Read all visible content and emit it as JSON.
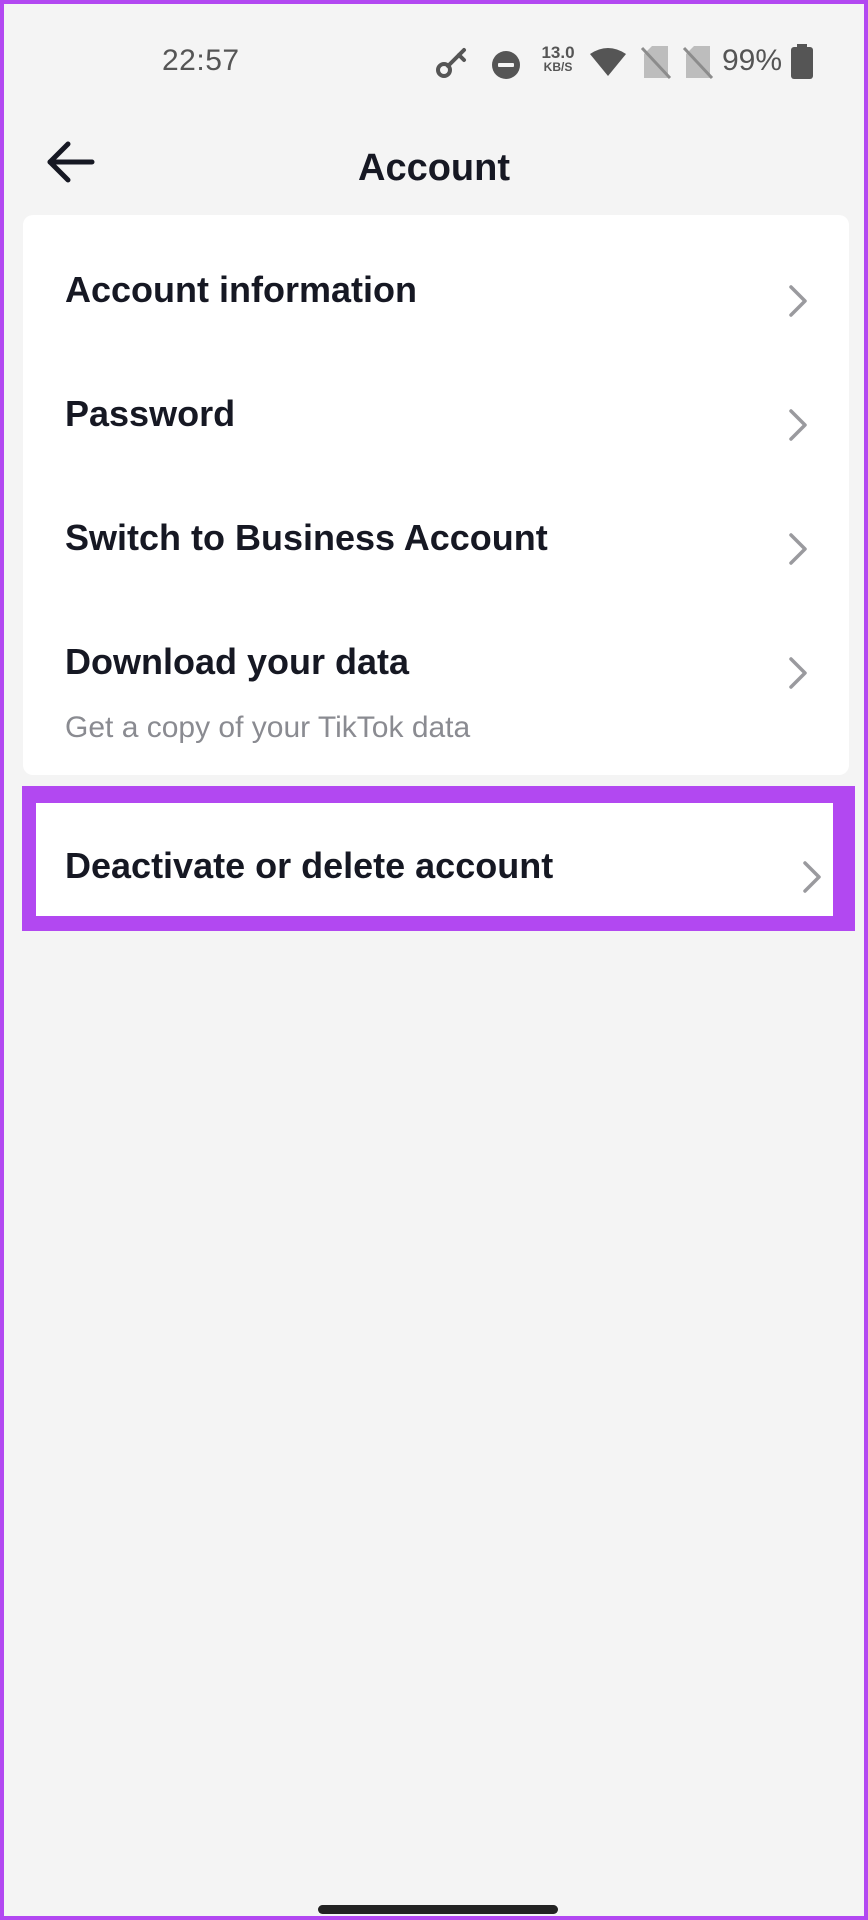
{
  "status_bar": {
    "time": "22:57",
    "net_speed_value": "13.0",
    "net_speed_unit": "KB/S",
    "battery_percent": "99%",
    "icons": [
      "vpn-key-icon",
      "do-not-disturb-icon",
      "wifi-icon",
      "no-sim-icon",
      "no-sim-icon",
      "battery-icon"
    ]
  },
  "header": {
    "back_icon": "arrow-left-icon",
    "title": "Account"
  },
  "menu": {
    "items": [
      {
        "label": "Account information",
        "icon": "chevron-right-icon"
      },
      {
        "label": "Password",
        "icon": "chevron-right-icon"
      },
      {
        "label": "Switch to Business Account",
        "icon": "chevron-right-icon"
      },
      {
        "label": "Download your data",
        "subtitle": "Get a copy of your TikTok data",
        "icon": "chevron-right-icon"
      },
      {
        "label": "Deactivate or delete account",
        "icon": "chevron-right-icon",
        "highlighted": true
      }
    ]
  },
  "colors": {
    "highlight": "#b248f1",
    "background": "#f4f4f4",
    "card": "#ffffff",
    "text_primary": "#161823",
    "text_secondary": "#8a8b91",
    "chevron": "#9a9a9e"
  }
}
